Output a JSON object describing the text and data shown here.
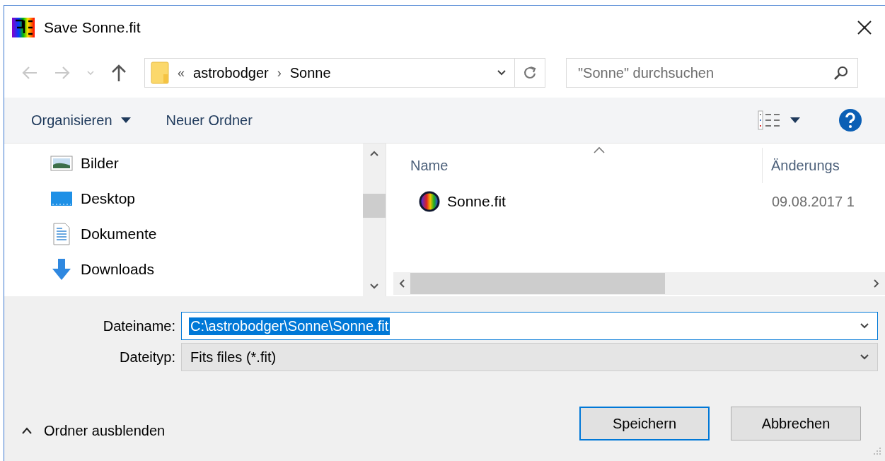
{
  "window": {
    "title": "Save Sonne.fit"
  },
  "navigation": {
    "buttons": [
      {
        "kind": "back",
        "disabled": true
      },
      {
        "kind": "forward",
        "disabled": true
      },
      {
        "kind": "recent",
        "disabled": true
      },
      {
        "kind": "up",
        "disabled": false
      }
    ],
    "address": {
      "overflow": "«",
      "separator": "›",
      "crumbs": [
        "astrobodger",
        "Sonne"
      ]
    },
    "search": {
      "placeholder": "\"Sonne\" durchsuchen"
    }
  },
  "toolbar": {
    "organize": "Organisieren",
    "new_folder": "Neuer Ordner"
  },
  "sidebar": {
    "items": [
      {
        "label": "Bilder",
        "kind": "pictures"
      },
      {
        "label": "Desktop",
        "kind": "desktop"
      },
      {
        "label": "Dokumente",
        "kind": "documents"
      },
      {
        "label": "Downloads",
        "kind": "downloads"
      }
    ]
  },
  "table": {
    "columns": [
      "Name",
      "Änderungs"
    ],
    "rows": [
      {
        "name": "Sonne.fit",
        "modified": "09.08.2017 1"
      }
    ]
  },
  "form": {
    "filename": {
      "label": "Dateiname:",
      "value": "C:\\astrobodger\\Sonne\\Sonne.fit",
      "selected": true
    },
    "filetype": {
      "label": "Dateityp:",
      "value": "Fits files (*.fit)"
    }
  },
  "footer": {
    "hide_folders": "Ordner ausblenden",
    "buttons": [
      {
        "label": "Speichern",
        "default": true
      },
      {
        "label": "Abbrechen",
        "default": false
      }
    ]
  }
}
